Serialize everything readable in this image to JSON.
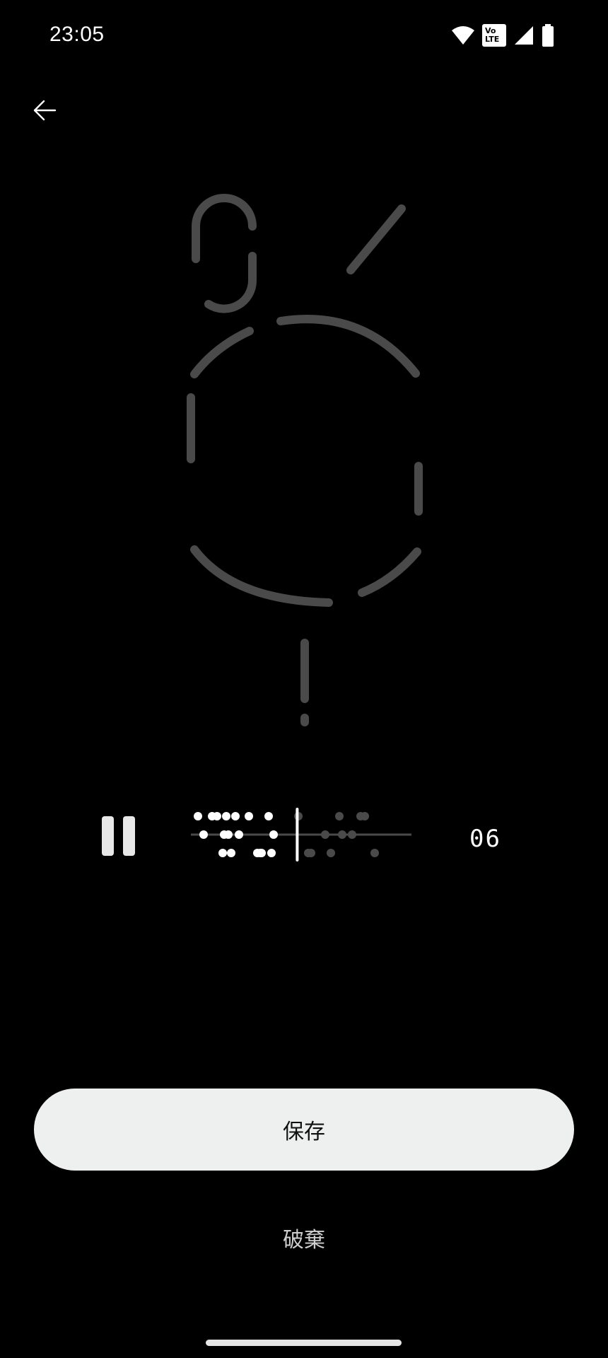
{
  "status_bar": {
    "time": "23:05",
    "icons": [
      "wifi-icon",
      "volte-icon",
      "signal-icon",
      "battery-icon"
    ],
    "volte_top": "Vo",
    "volte_bottom": "LTE"
  },
  "header": {
    "back_icon": "arrow-left-icon"
  },
  "glyph_composition": {
    "icon": "nothing-phone-glyph-pattern",
    "stroke_color": "#4a4a4a"
  },
  "playback": {
    "state": "playing",
    "pause_icon": "pause-icon",
    "timer": "06",
    "played_color": "#ffffff",
    "unplayed_color": "#4a4a4a",
    "progress": 0.47
  },
  "actions": {
    "save_label": "保存",
    "discard_label": "破棄"
  }
}
